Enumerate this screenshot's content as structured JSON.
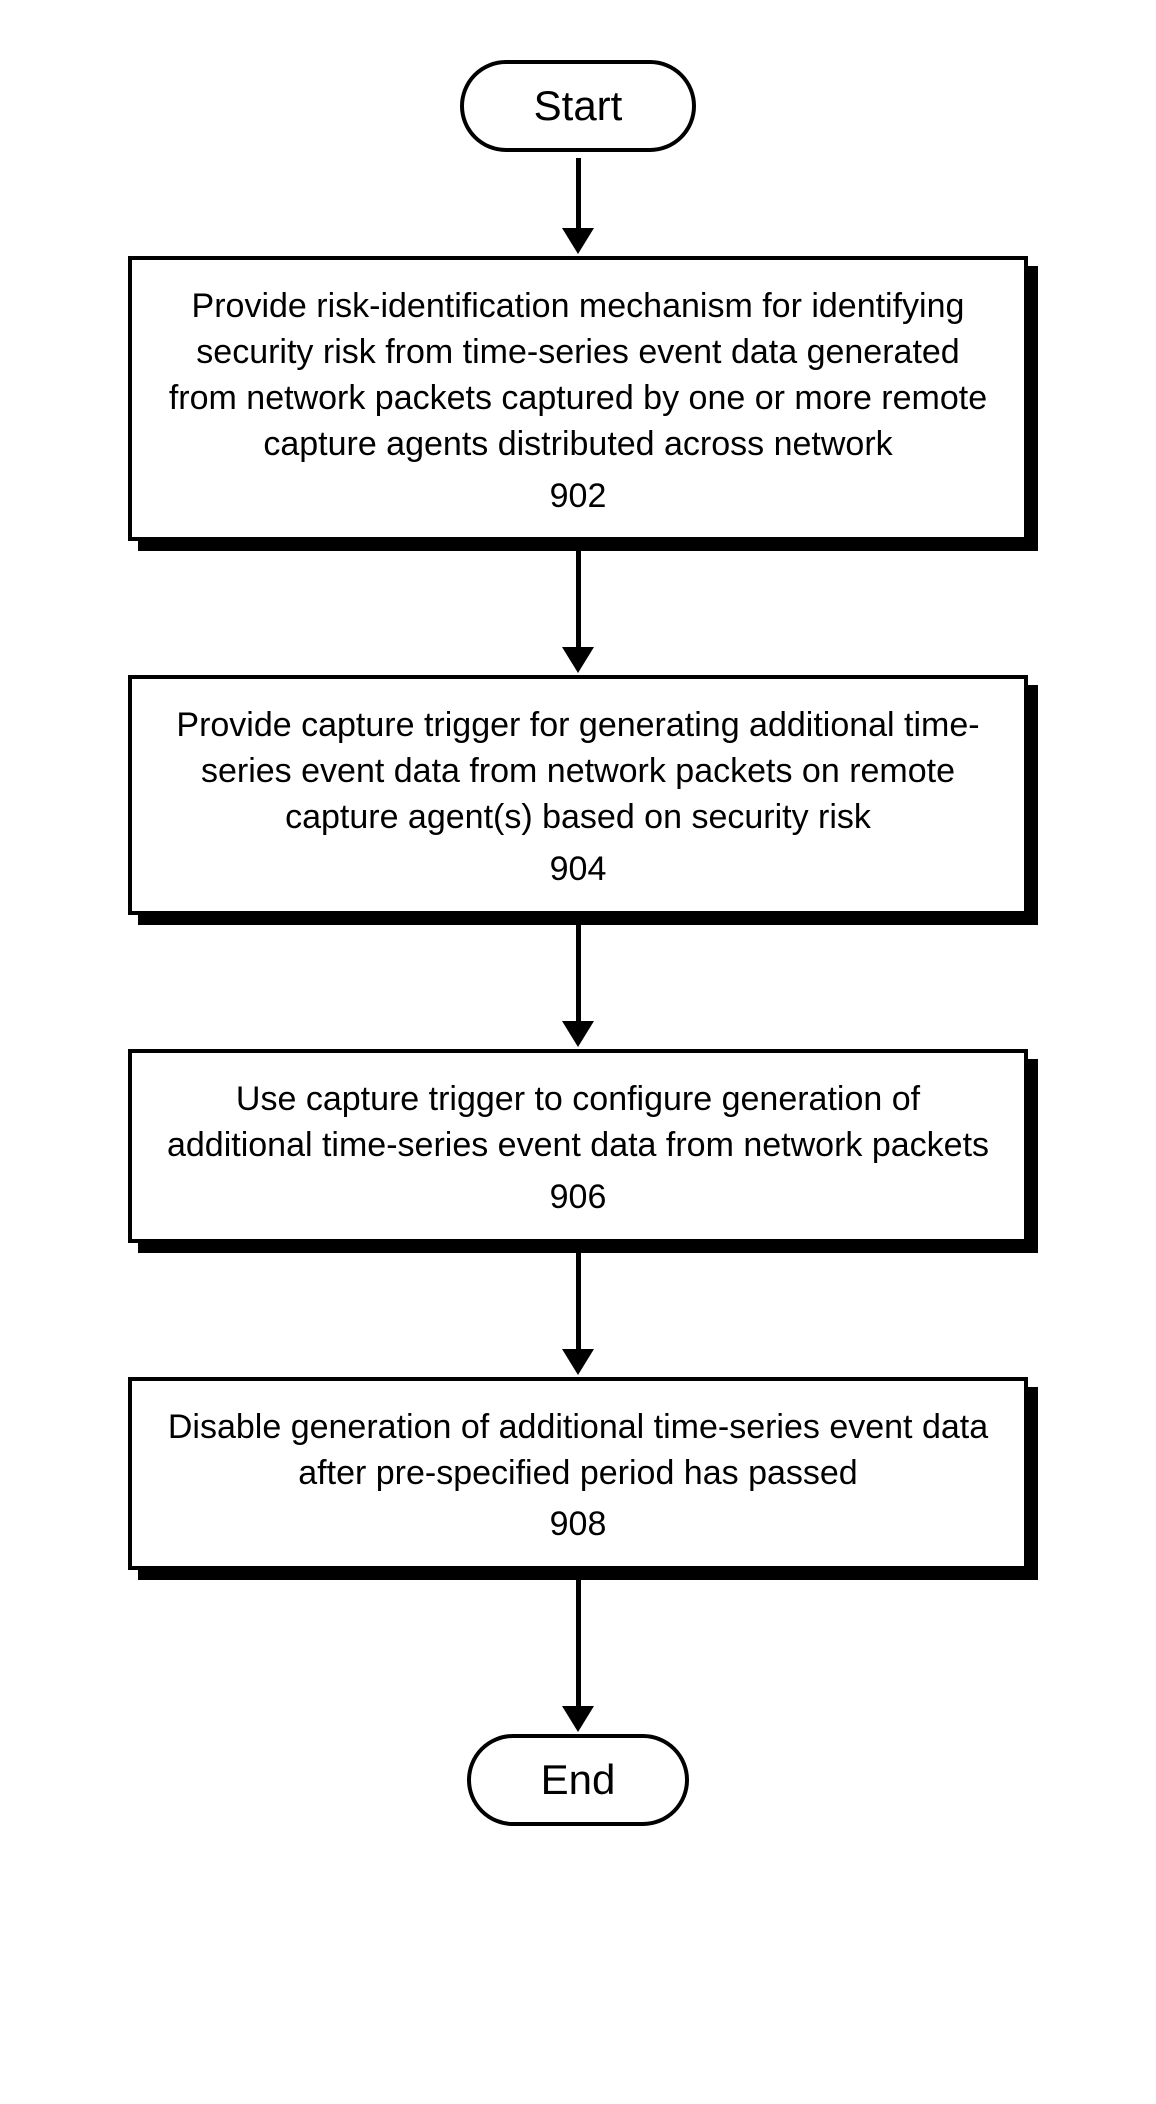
{
  "flow": {
    "start": "Start",
    "end": "End",
    "steps": [
      {
        "text": "Provide risk-identification mechanism for identifying security risk from time-series event data generated from network packets captured by one or more remote capture agents distributed across network",
        "ref": "902"
      },
      {
        "text": "Provide capture trigger for generating additional time-series event data from network packets on remote capture agent(s) based on security risk",
        "ref": "904"
      },
      {
        "text": "Use capture trigger to configure generation of additional time-series event data from network packets",
        "ref": "906"
      },
      {
        "text": "Disable generation of additional time-series event data after pre-specified period has passed",
        "ref": "908"
      }
    ]
  }
}
